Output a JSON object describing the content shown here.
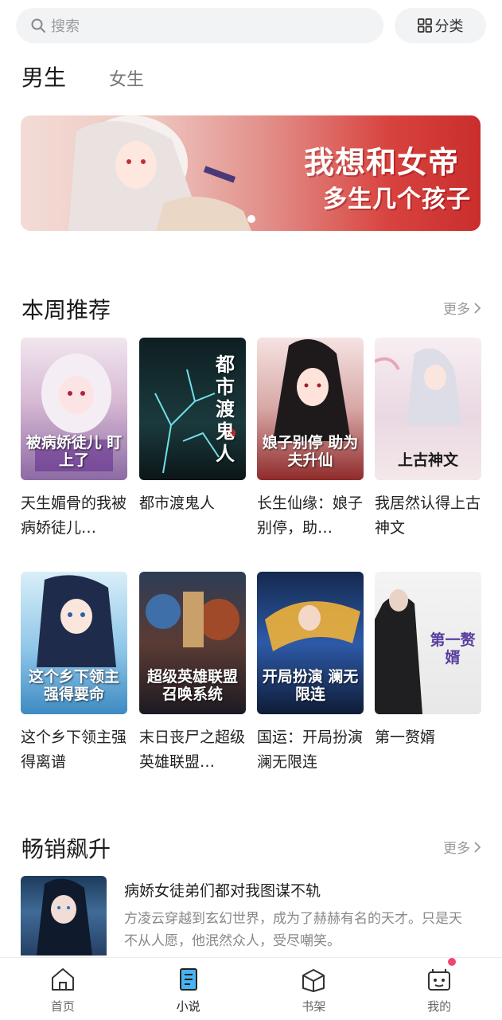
{
  "search": {
    "placeholder": "搜索"
  },
  "category_button": {
    "label": "分类"
  },
  "gender_tabs": [
    {
      "label": "男生",
      "active": true
    },
    {
      "label": "女生",
      "active": false
    }
  ],
  "banner": {
    "line1": "我想和女帝",
    "line2": "多生几个孩子"
  },
  "weekly": {
    "title": "本周推荐",
    "more": "更多",
    "books": [
      {
        "title": "天生媚骨的我被病娇徒儿…",
        "cover_text": "被病娇徒儿 盯上了"
      },
      {
        "title": "都市渡鬼人",
        "cover_text": "都市渡鬼人"
      },
      {
        "title": "长生仙缘：娘子别停，助…",
        "cover_text": "娘子别停 助为夫升仙"
      },
      {
        "title": "我居然认得上古神文",
        "cover_text": "上古神文"
      },
      {
        "title": "这个乡下领主强得离谱",
        "cover_text": "这个乡下领主 强得要命"
      },
      {
        "title": "末日丧尸之超级英雄联盟…",
        "cover_text": "超级英雄联盟 召唤系统"
      },
      {
        "title": "国运：开局扮演澜无限连",
        "cover_text": "开局扮演 澜无限连"
      },
      {
        "title": "第一赘婿",
        "cover_text": "第一赘婿"
      }
    ]
  },
  "bestseller": {
    "title": "畅销飙升",
    "more": "更多",
    "item": {
      "title": "病娇女徒弟们都对我图谋不轨",
      "desc": "方凌云穿越到玄幻世界，成为了赫赫有名的天才。只是天不从人愿，他泯然众人，受尽嘲笑。"
    }
  },
  "tabbar": [
    {
      "label": "首页",
      "icon": "home-icon"
    },
    {
      "label": "小说",
      "icon": "novel-icon",
      "active": true
    },
    {
      "label": "书架",
      "icon": "bookshelf-icon"
    },
    {
      "label": "我的",
      "icon": "profile-icon"
    }
  ],
  "colors": {
    "accent_badge": "#f0466e",
    "banner_red": "#c92e2c"
  }
}
